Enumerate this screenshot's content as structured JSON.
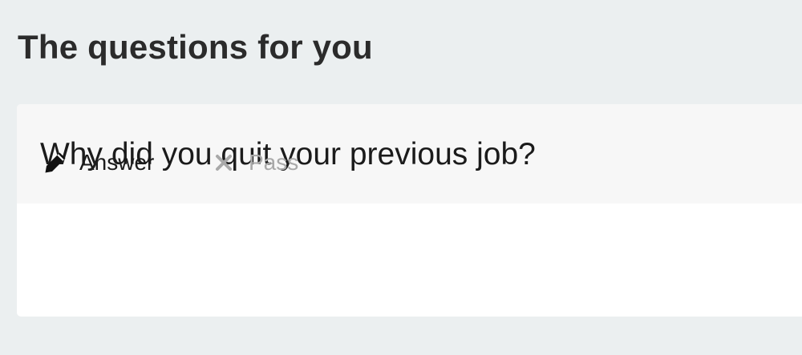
{
  "section": {
    "title": "The questions for you"
  },
  "question": {
    "text": "Why did you quit your previous job?"
  },
  "actions": {
    "answer": {
      "label": "Answer",
      "icon": "pencil-icon"
    },
    "pass": {
      "label": "Pass",
      "icon": "x-icon"
    }
  },
  "colors": {
    "page_background": "#ebeff0",
    "card_header_background": "#f7f7f7",
    "card_background": "#ffffff",
    "primary_text": "#1b1b1b",
    "muted_text": "#a9a9a9"
  }
}
